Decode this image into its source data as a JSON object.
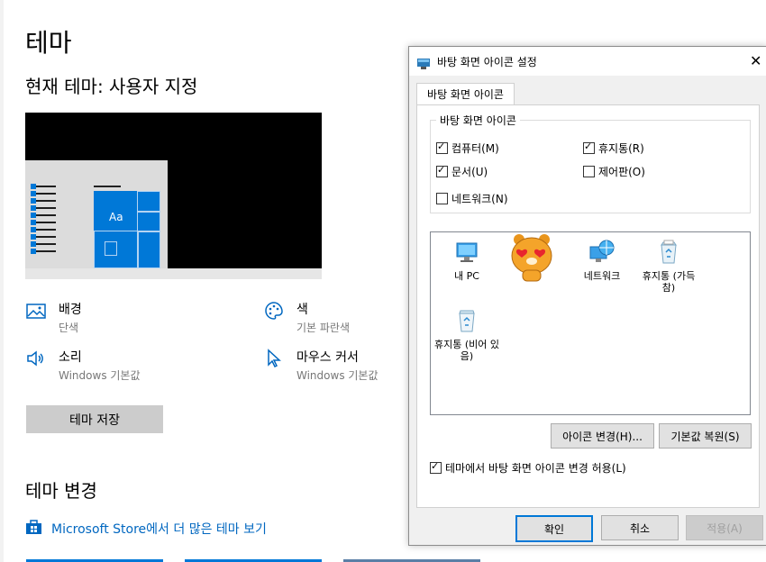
{
  "settings": {
    "page_title": "테마",
    "current_theme": "현재 테마: 사용자 지정",
    "preview_tile_label": "Aa",
    "options": [
      {
        "title": "배경",
        "subtitle": "단색",
        "icon": "picture-icon"
      },
      {
        "title": "색",
        "subtitle": "기본 파란색",
        "icon": "palette-icon"
      },
      {
        "title": "소리",
        "subtitle": "Windows 기본값",
        "icon": "speaker-icon"
      },
      {
        "title": "마우스 커서",
        "subtitle": "Windows 기본값",
        "icon": "cursor-icon"
      }
    ],
    "save_button": "테마 저장",
    "change_title": "테마 변경",
    "store_link": "Microsoft Store에서 더 많은 테마 보기",
    "accent": "#0078d7"
  },
  "dialog": {
    "title": "바탕 화면 아이콘 설정",
    "tab": "바탕 화면 아이콘",
    "group_label": "바탕 화면 아이콘",
    "checkboxes": [
      {
        "label": "컴퓨터(M)",
        "checked": true
      },
      {
        "label": "휴지통(R)",
        "checked": true
      },
      {
        "label": "문서(U)",
        "checked": true
      },
      {
        "label": "제어판(O)",
        "checked": false
      },
      {
        "label": "네트워크(N)",
        "checked": false
      }
    ],
    "icons": [
      {
        "label": "내 PC",
        "icon": "monitor-icon"
      },
      {
        "label": "",
        "icon": "character-sticker-icon"
      },
      {
        "label": "네트워크",
        "icon": "network-globe-icon"
      },
      {
        "label": "휴지통 (가득 참)",
        "icon": "recycle-bin-full-icon"
      },
      {
        "label": "휴지통 (비어 있음)",
        "icon": "recycle-bin-empty-icon"
      }
    ],
    "change_icon_button": "아이콘 변경(H)...",
    "restore_default_button": "기본값 복원(S)",
    "allow_themes_checkbox": {
      "label": "테마에서 바탕 화면 아이콘 변경 허용(L)",
      "checked": true
    },
    "ok_button": "확인",
    "cancel_button": "취소",
    "apply_button": "적용(A)"
  }
}
